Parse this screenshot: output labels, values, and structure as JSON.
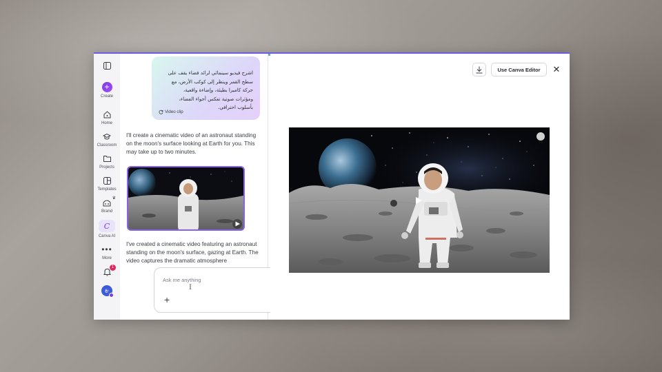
{
  "sidebar": {
    "items": [
      {
        "label": "Create",
        "icon": "plus-icon"
      },
      {
        "label": "Home",
        "icon": "home-icon"
      },
      {
        "label": "Classroom",
        "icon": "graduation-cap-icon"
      },
      {
        "label": "Projects",
        "icon": "folder-icon"
      },
      {
        "label": "Templates",
        "icon": "templates-icon"
      },
      {
        "label": "Brand",
        "icon": "brand-icon"
      },
      {
        "label": "Canva AI",
        "icon": "canva-ai-icon"
      },
      {
        "label": "More",
        "icon": "more-dots-icon"
      }
    ],
    "notifications_count": "1",
    "avatar_initials": "نغ"
  },
  "chat": {
    "user_prompt": "اشرح فيديو سينمائي لرائد فضاء يقف على سطح القمر وينظر إلى كوكب الأرض، مع حركة كاميرا بطيئة، وإضاءة واقعية، ومؤثرات صوتية تعكس أجواء الفضاء، بأسلوب احترافي.",
    "user_prompt_lines": [
      "اشرح فيديو سينمائي لرائد فضاء يقف على",
      "سطح القمر وينظر إلى كوكب الأرض، مع",
      "حركة كاميرا بطيئة، وإضاءة واقعية،",
      "ومؤثرات صوتية تعكس أجواء الفضاء،",
      "بأسلوب احترافي."
    ],
    "clip_tag": "Video clip",
    "assistant_msg_1": "I'll create a cinematic video of an astronaut standing on the moon's surface looking at Earth for you. This may take up to two minutes.",
    "assistant_msg_2": "I've created a cinematic video featuring an astronaut standing on the moon's surface, gazing at Earth. The video captures the dramatic atmosphere",
    "input_placeholder": "Ask me anything"
  },
  "preview": {
    "use_editor_label": "Use Canva Editor"
  },
  "colors": {
    "accent": "#7b3fe4",
    "badge": "#e0245e"
  }
}
